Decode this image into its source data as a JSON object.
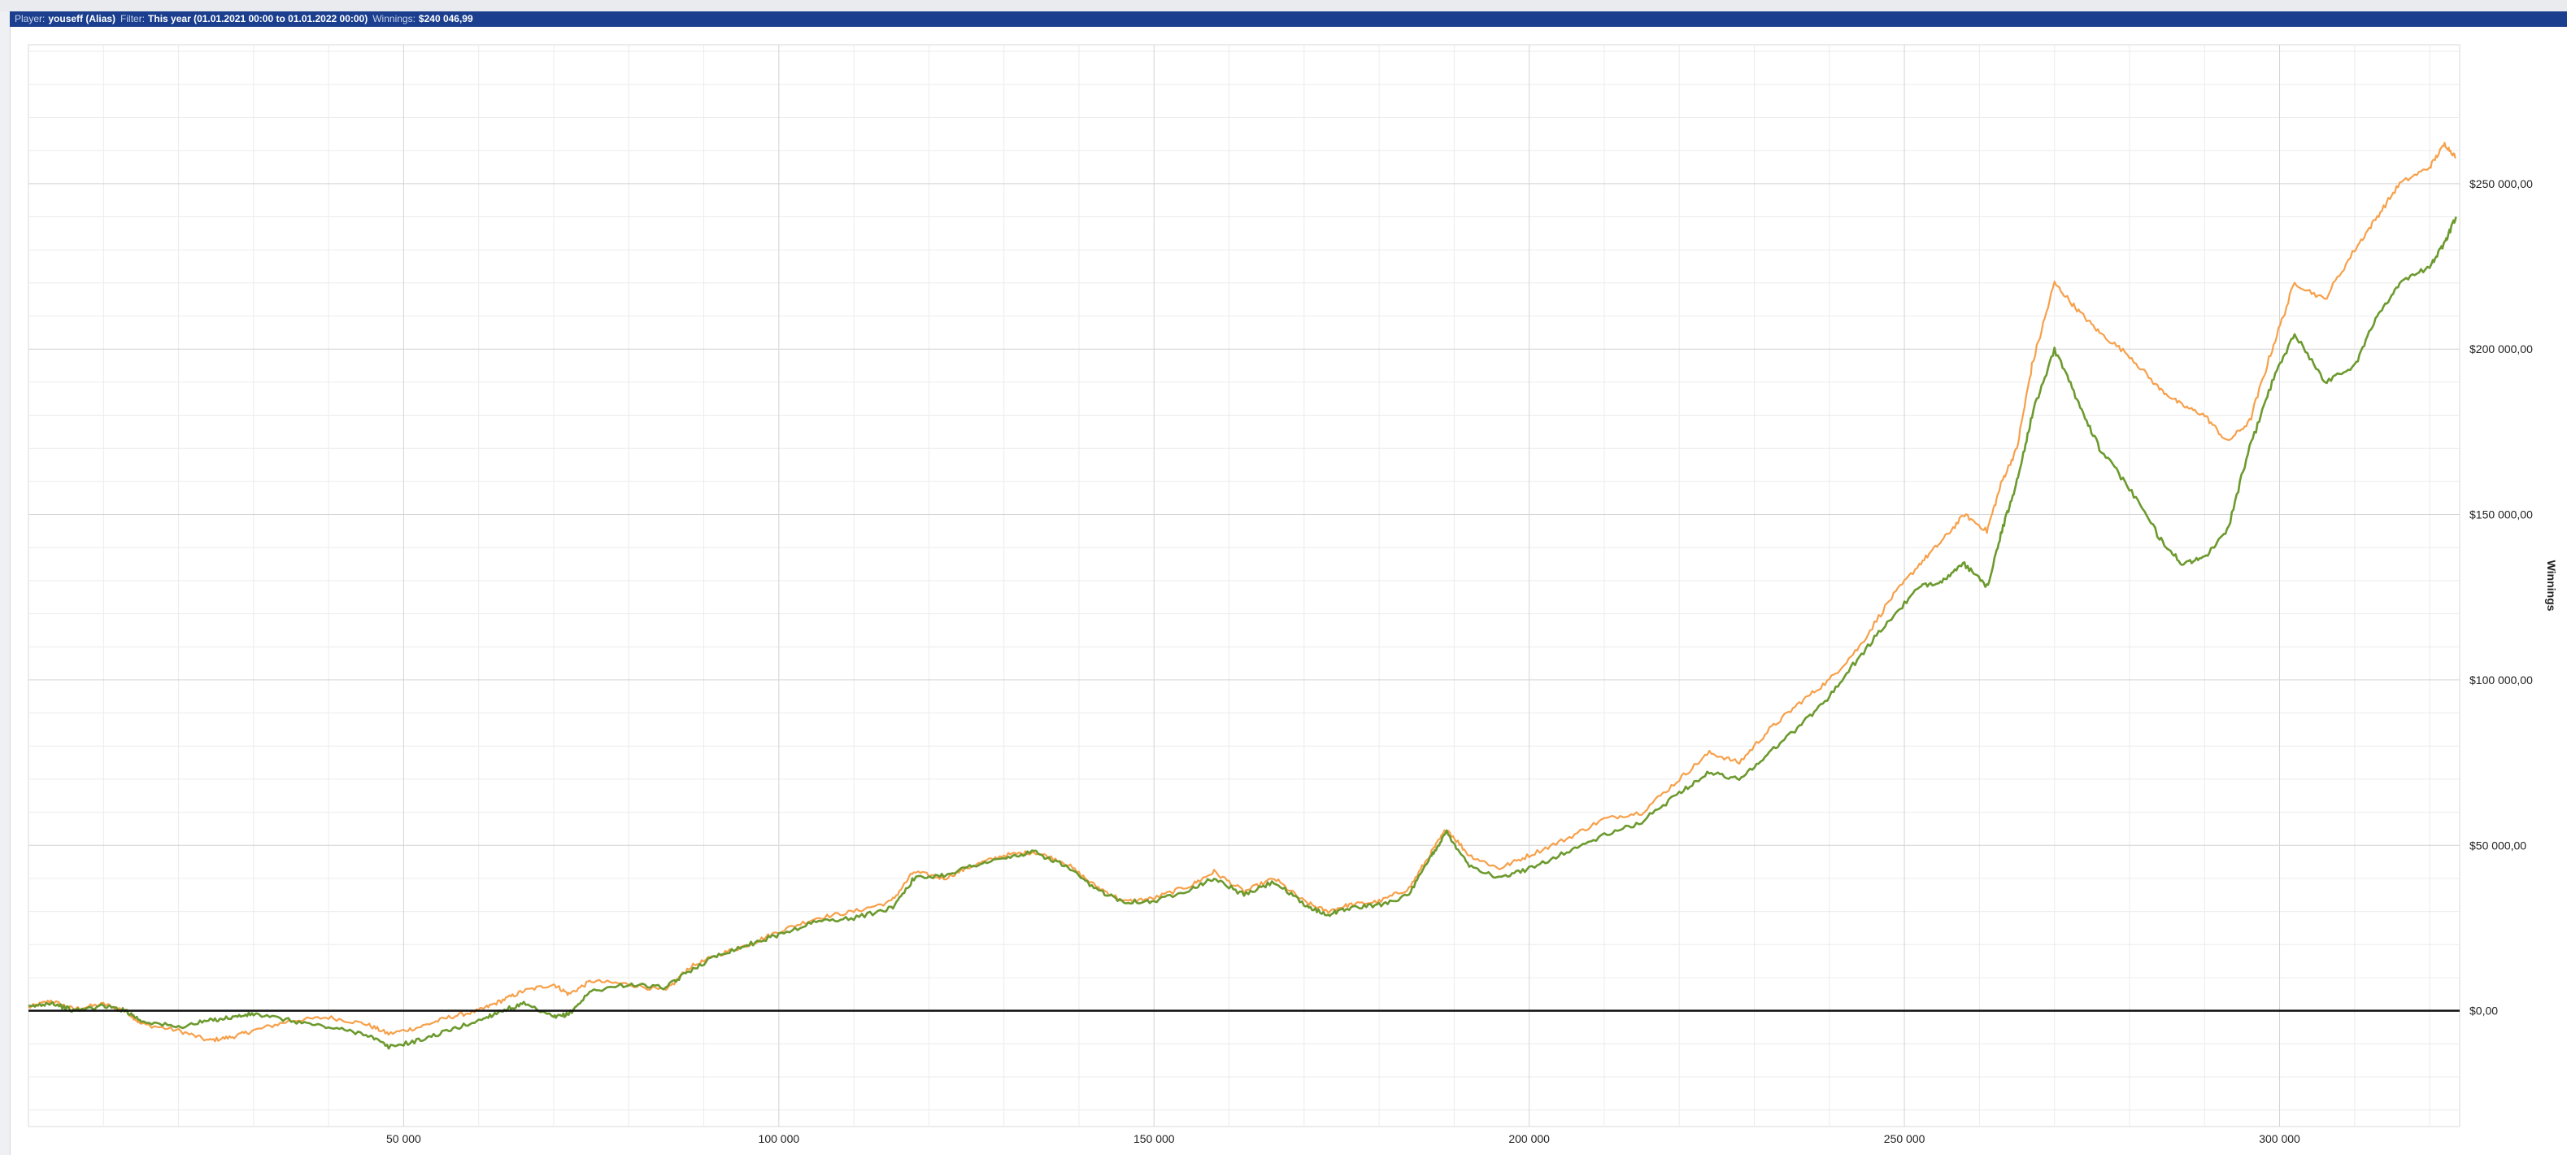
{
  "info_bar": {
    "player_label": "Player:",
    "player_value": "youseff (Alias)",
    "filter_label": "Filter:",
    "filter_value": "This year (01.01.2021 00:00 to 01.01.2022 00:00)",
    "winnings_label": "Winnings:",
    "winnings_value": "$240 046,99"
  },
  "chart_data": {
    "type": "line",
    "ylabel": "Winnings",
    "xlabel": "",
    "xlim": [
      0,
      324000
    ],
    "ylim": [
      -35000,
      292000
    ],
    "y_ticks": [
      0,
      50000,
      100000,
      150000,
      200000,
      250000
    ],
    "y_tick_labels": [
      "$0,00",
      "$50 000,00",
      "$100 000,00",
      "$150 000,00",
      "$200 000,00",
      "$250 000,00"
    ],
    "x_ticks": [
      50000,
      100000,
      150000,
      200000,
      250000,
      300000
    ],
    "x_tick_labels": [
      "50 000",
      "100 000",
      "150 000",
      "200 000",
      "250 000",
      "300 000"
    ],
    "grid": true,
    "zero_line": true,
    "series": [
      {
        "color": "#f7a04a",
        "x": [
          0,
          3000,
          6000,
          10000,
          13000,
          15000,
          20000,
          24000,
          27000,
          30000,
          35000,
          40000,
          45000,
          48000,
          52000,
          56000,
          60000,
          63000,
          66000,
          70000,
          72000,
          75000,
          80000,
          85000,
          88000,
          92000,
          96000,
          100000,
          105000,
          110000,
          115000,
          118000,
          122000,
          126000,
          130000,
          134000,
          138000,
          142000,
          146000,
          150000,
          155000,
          158000,
          162000,
          166000,
          170000,
          173000,
          176000,
          180000,
          184000,
          187000,
          189000,
          192000,
          196000,
          200000,
          205000,
          210000,
          215000,
          220000,
          224000,
          228000,
          232000,
          236000,
          240000,
          244000,
          248000,
          252000,
          255000,
          258000,
          261000,
          263000,
          265000,
          267000,
          270000,
          273000,
          276000,
          280000,
          284000,
          287000,
          290000,
          293000,
          296000,
          299000,
          302000,
          306000,
          310000,
          313000,
          316000,
          320000,
          322000,
          323500
        ],
        "y": [
          1000,
          3000,
          500,
          2000,
          0,
          -4000,
          -6000,
          -9000,
          -8000,
          -6000,
          -3000,
          -2000,
          -4000,
          -7000,
          -5000,
          -2000,
          0,
          3000,
          6000,
          8000,
          5000,
          9000,
          8000,
          6000,
          13000,
          17000,
          20000,
          24000,
          28000,
          30000,
          33000,
          42000,
          40000,
          44000,
          47000,
          48000,
          45000,
          38000,
          33000,
          34000,
          38000,
          42000,
          36000,
          40000,
          33000,
          30000,
          32000,
          33000,
          37000,
          48000,
          55000,
          47000,
          43000,
          47000,
          52000,
          58000,
          60000,
          70000,
          78000,
          75000,
          85000,
          93000,
          100000,
          110000,
          124000,
          135000,
          142000,
          150000,
          145000,
          160000,
          170000,
          195000,
          220000,
          212000,
          205000,
          198000,
          188000,
          183000,
          180000,
          172000,
          178000,
          200000,
          220000,
          215000,
          230000,
          240000,
          250000,
          255000,
          262000,
          258000
        ]
      },
      {
        "color": "#6c9a2e",
        "x": [
          0,
          3000,
          6000,
          10000,
          13000,
          15000,
          20000,
          24000,
          27000,
          30000,
          35000,
          40000,
          45000,
          48000,
          52000,
          56000,
          60000,
          63000,
          66000,
          70000,
          72000,
          75000,
          80000,
          85000,
          88000,
          92000,
          96000,
          100000,
          105000,
          110000,
          115000,
          118000,
          122000,
          126000,
          130000,
          134000,
          138000,
          142000,
          146000,
          150000,
          155000,
          158000,
          162000,
          166000,
          170000,
          173000,
          176000,
          180000,
          184000,
          187000,
          189000,
          192000,
          196000,
          200000,
          205000,
          210000,
          215000,
          220000,
          224000,
          228000,
          232000,
          236000,
          240000,
          244000,
          248000,
          252000,
          255000,
          258000,
          261000,
          263000,
          265000,
          267000,
          270000,
          273000,
          276000,
          280000,
          284000,
          287000,
          290000,
          293000,
          296000,
          299000,
          302000,
          306000,
          310000,
          313000,
          316000,
          320000,
          322000,
          323500
        ],
        "y": [
          1000,
          2500,
          0,
          1500,
          0,
          -3000,
          -5000,
          -3000,
          -2000,
          -1000,
          -3000,
          -5000,
          -7000,
          -11000,
          -9000,
          -6000,
          -3000,
          0,
          2000,
          -2000,
          -1000,
          6000,
          8000,
          7000,
          12000,
          17000,
          20000,
          23000,
          27000,
          28000,
          31000,
          40000,
          41000,
          44000,
          46000,
          48000,
          44000,
          37000,
          33000,
          33000,
          37000,
          40000,
          35000,
          39000,
          32000,
          29000,
          31000,
          32000,
          35000,
          47000,
          54000,
          44000,
          40000,
          43000,
          48000,
          53000,
          57000,
          66000,
          72000,
          70000,
          78000,
          86000,
          95000,
          107000,
          118000,
          128000,
          130000,
          135000,
          128000,
          145000,
          160000,
          180000,
          200000,
          185000,
          170000,
          158000,
          143000,
          135000,
          137000,
          145000,
          170000,
          190000,
          205000,
          190000,
          195000,
          210000,
          220000,
          225000,
          232000,
          240000
        ]
      }
    ]
  }
}
